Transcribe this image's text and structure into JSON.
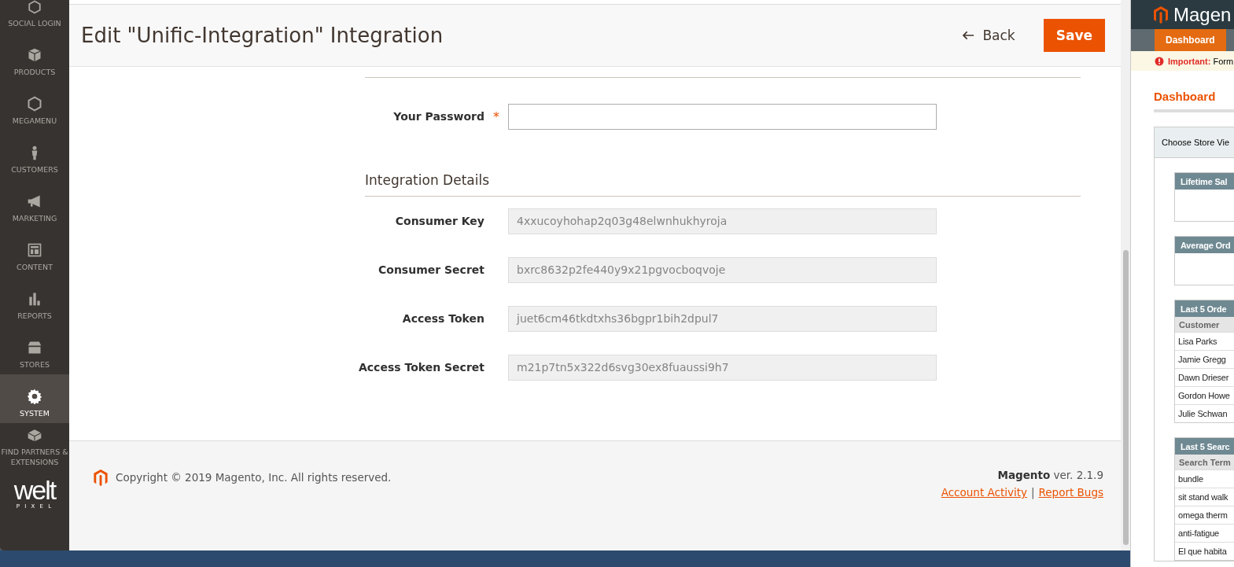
{
  "sidebar": {
    "items": [
      {
        "label": "SOCIAL LOGIN",
        "selected": false
      },
      {
        "label": "PRODUCTS",
        "selected": false
      },
      {
        "label": "MEGAMENU",
        "selected": false
      },
      {
        "label": "CUSTOMERS",
        "selected": false
      },
      {
        "label": "MARKETING",
        "selected": false
      },
      {
        "label": "CONTENT",
        "selected": false
      },
      {
        "label": "REPORTS",
        "selected": false
      },
      {
        "label": "STORES",
        "selected": false
      },
      {
        "label": "SYSTEM",
        "selected": true
      },
      {
        "label": "FIND PARTNERS & EXTENSIONS",
        "selected": false
      }
    ],
    "logo": {
      "word": "welt",
      "sub": "P I X E L"
    }
  },
  "header": {
    "title": "Edit \"Unific-Integration\" Integration",
    "back": "Back",
    "save": "Save"
  },
  "password": {
    "label": "Your Password",
    "required_mark": "*",
    "required": true
  },
  "integration_details": {
    "title": "Integration Details",
    "fields": [
      {
        "label": "Consumer Key",
        "value": "4xxucoyhohap2q03g48elwnhukhyroja"
      },
      {
        "label": "Consumer Secret",
        "value": "bxrc8632p2fe440y9x21pgvocboqvoje"
      },
      {
        "label": "Access Token",
        "value": "juet6cm46tkdtxhs36bgpr1bih2dpul7"
      },
      {
        "label": "Access Token Secret",
        "value": "m21p7tn5x322d6svg30ex8fuaussi9h7"
      }
    ]
  },
  "footer": {
    "copyright": "Copyright © 2019 Magento, Inc. All rights reserved.",
    "brand": "Magento",
    "version": "ver. 2.1.9",
    "links": [
      "Account Activity",
      "Report Bugs"
    ],
    "separator": "|"
  },
  "second_window": {
    "logo": "Magen",
    "tab": "Dashboard",
    "notice_label": "Important:",
    "notice": "Form",
    "heading": "Dashboard",
    "store_view": "Choose Store Vie",
    "widgets": [
      {
        "title": "Lifetime Sal"
      },
      {
        "title": "Average Ord"
      },
      {
        "title": "Last 5 Orde",
        "column": "Customer",
        "rows": [
          "Lisa Parks",
          "Jamie Gregg",
          "Dawn Drieser",
          "Gordon Howe",
          "Julie Schwan"
        ]
      },
      {
        "title": "Last 5 Searc",
        "column": "Search Term",
        "rows": [
          "bundle",
          "sit stand walk",
          "omega therm",
          "anti-fatigue",
          "El que habita"
        ]
      }
    ]
  }
}
